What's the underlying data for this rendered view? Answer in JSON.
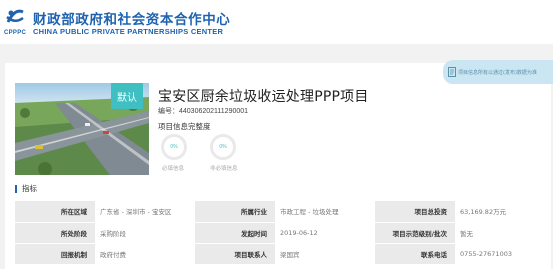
{
  "header": {
    "org_name_cn": "财政部政府和社会资本合作中心",
    "org_name_en": "CHINA PUBLIC PRIVATE PARTNERSHIPS CENTER",
    "logo_text": "CPPPC"
  },
  "project": {
    "badge": "默认",
    "title": "宝安区厨余垃圾收运处理PPP项目",
    "code": "编号：44030620211129000​1",
    "completeness_title": "项目信息完整度",
    "required_percent": "0%",
    "required_label": "必填信息",
    "optional_percent": "0%",
    "optional_label": "非必填信息"
  },
  "notice": {
    "text": "项目信息所有以通过(发布)数据为准"
  },
  "indicators": {
    "heading": "指标",
    "rows": [
      {
        "l1": "所在区域",
        "v1": "广东省 - 深圳市 - 宝安区",
        "l2": "所属行业",
        "v2": "市政工程 - 垃圾处理",
        "l3": "项目总投资",
        "v3": "63,169.82万元"
      },
      {
        "l1": "所处阶段",
        "v1": "采购阶段",
        "l2": "发起时间",
        "v2": "2019-06-12",
        "l3": "项目示范级别/批次",
        "v3": "暂无"
      },
      {
        "l1": "回报机制",
        "v1": "政府付费",
        "l2": "项目联系人",
        "v2": "梁国宾",
        "l3": "联系电话",
        "v3": "0755-27671003"
      }
    ]
  },
  "colors": {
    "brand_blue": "#1f63b0",
    "accent_teal": "#3fbfc1"
  }
}
